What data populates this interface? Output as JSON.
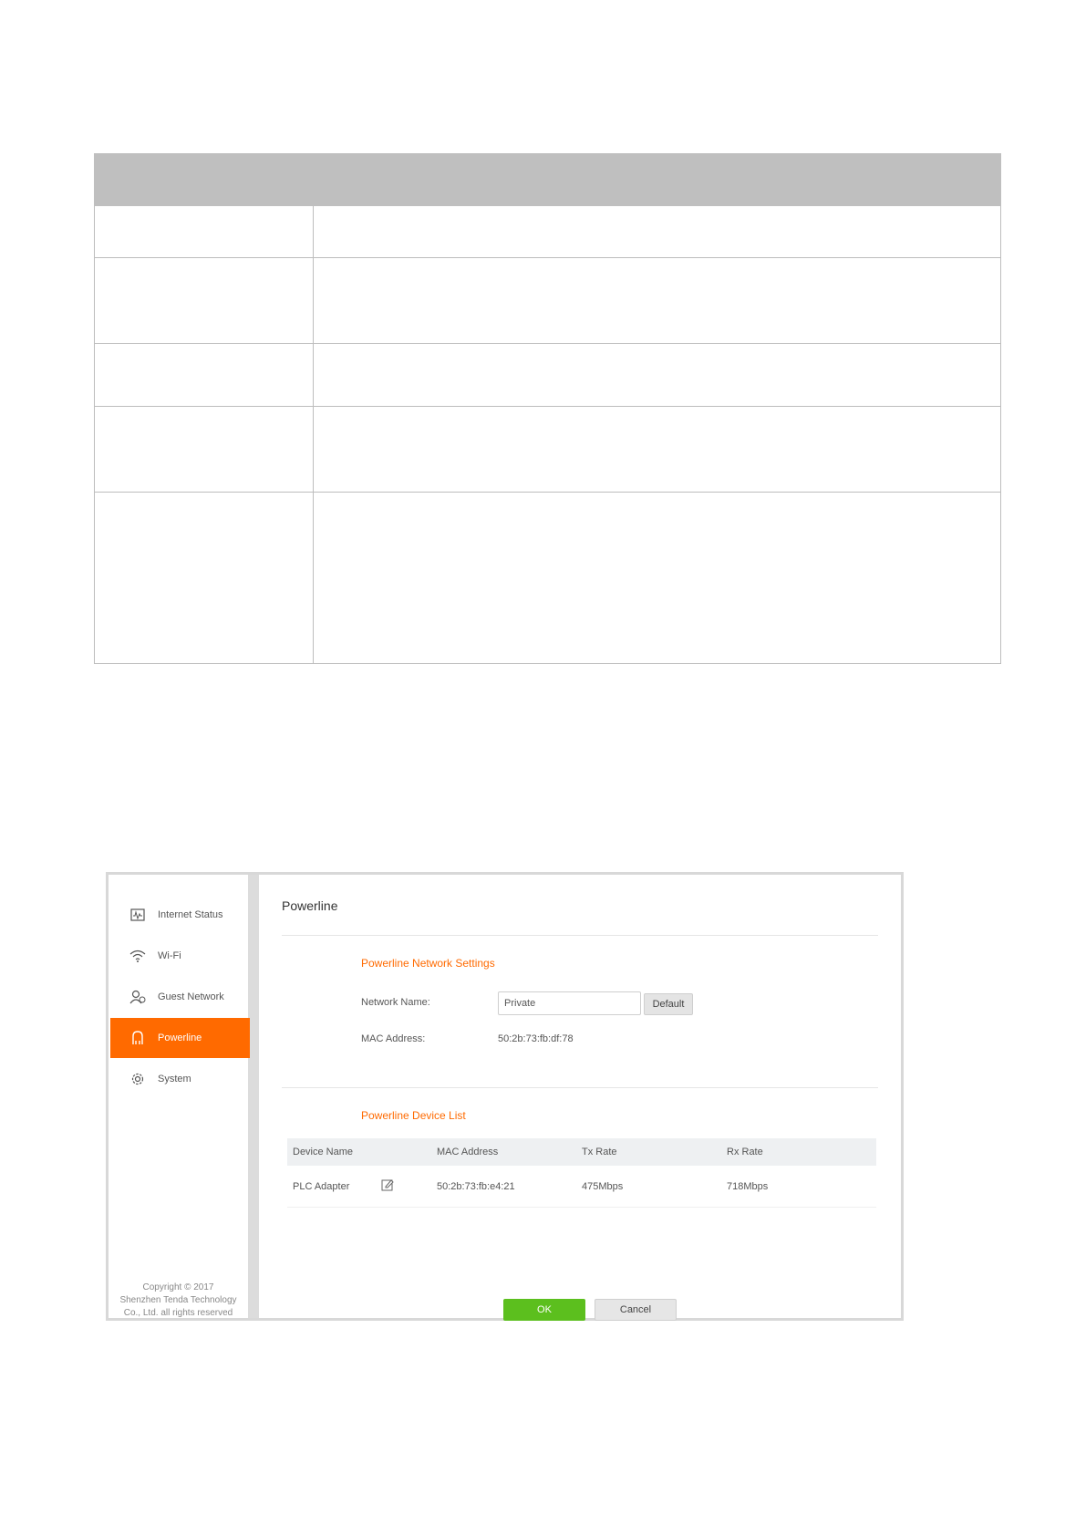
{
  "sidebar": {
    "items": [
      {
        "label": "Internet Status",
        "icon": "internet-status-icon"
      },
      {
        "label": "Wi-Fi",
        "icon": "wifi-icon"
      },
      {
        "label": "Guest Network",
        "icon": "guest-network-icon"
      },
      {
        "label": "Powerline",
        "icon": "powerline-icon",
        "active": true
      },
      {
        "label": "System",
        "icon": "gear-icon"
      }
    ],
    "copyright": [
      "Copyright © 2017",
      "Shenzhen Tenda Technology",
      "Co., Ltd. all rights reserved"
    ]
  },
  "main": {
    "title": "Powerline",
    "settings": {
      "title": "Powerline Network Settings",
      "network_name_label": "Network Name:",
      "network_name_value": "Private",
      "default_button": "Default",
      "mac_label": "MAC Address:",
      "mac_value": "50:2b:73:fb:df:78"
    },
    "device_list": {
      "title": "Powerline Device List",
      "columns": [
        "Device Name",
        "MAC Address",
        "Tx Rate",
        "Rx Rate"
      ],
      "rows": [
        {
          "device_name": "PLC Adapter",
          "mac": "50:2b:73:fb:e4:21",
          "tx": "475Mbps",
          "rx": "718Mbps"
        }
      ]
    },
    "ok_button": "OK",
    "cancel_button": "Cancel"
  },
  "colors": {
    "accent": "#ff6a00",
    "ok": "#5cbf1e"
  }
}
